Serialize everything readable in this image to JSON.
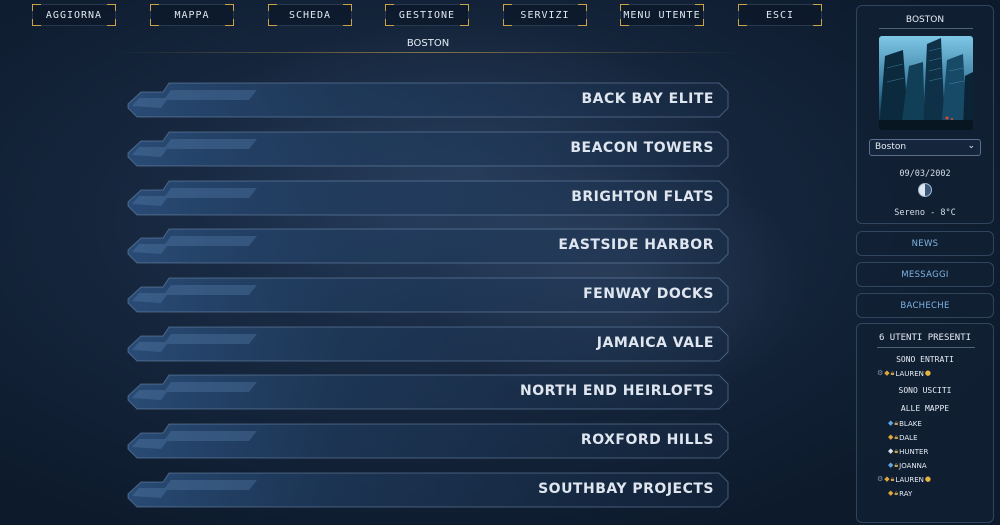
{
  "nav": {
    "items": [
      "AGGIORNA",
      "MAPPA",
      "SCHEDA",
      "GESTIONE",
      "SERVIZI",
      "MENU UTENTE",
      "ESCI"
    ]
  },
  "main": {
    "title": "BOSTON",
    "locations": [
      "BACK BAY ELITE",
      "BEACON TOWERS",
      "BRIGHTON FLATS",
      "EASTSIDE HARBOR",
      "FENWAY DOCKS",
      "JAMAICA VALE",
      "NORTH END HEIRLOFTS",
      "ROXFORD HILLS",
      "SOUTHBAY PROJECTS"
    ]
  },
  "sidebar": {
    "city": {
      "name": "BOSTON",
      "select_value": "Boston",
      "date": "09/03/2002",
      "weather": "Sereno - 8°C",
      "moon_icon": "half-moon-icon"
    },
    "buttons": [
      "NEWS",
      "MESSAGGI",
      "BACHECHE"
    ],
    "users": {
      "count_label": "6 UTENTI PRESENTI",
      "entered_label": "SONO ENTRATI",
      "exited_label": "SONO USCITI",
      "maps_label": "ALLE MAPPE",
      "entered": [
        {
          "name": "LAUREN",
          "icons": [
            "gear-icon",
            "diamond-gold-icon",
            "lock-icon"
          ],
          "pin": true
        }
      ],
      "on_maps": [
        {
          "name": "BLAKE",
          "icons": [
            "diamond-blue-icon",
            "lock-icon"
          ],
          "pin": false
        },
        {
          "name": "DALE",
          "icons": [
            "diamond-gold-icon",
            "lock-icon"
          ],
          "pin": false
        },
        {
          "name": "HUNTER",
          "icons": [
            "diamond-white-icon",
            "lock-icon"
          ],
          "pin": false
        },
        {
          "name": "JOANNA",
          "icons": [
            "diamond-blue-icon",
            "lock-icon"
          ],
          "pin": false
        },
        {
          "name": "LAUREN",
          "icons": [
            "gear-icon",
            "diamond-gold-icon",
            "lock-icon"
          ],
          "pin": true
        },
        {
          "name": "RAY",
          "icons": [
            "diamond-gold-icon",
            "lock-icon"
          ],
          "pin": false
        }
      ]
    }
  },
  "colors": {
    "accent_gold": "#c9a24a",
    "link_blue": "#7fb3e3",
    "background": "#14243a"
  }
}
